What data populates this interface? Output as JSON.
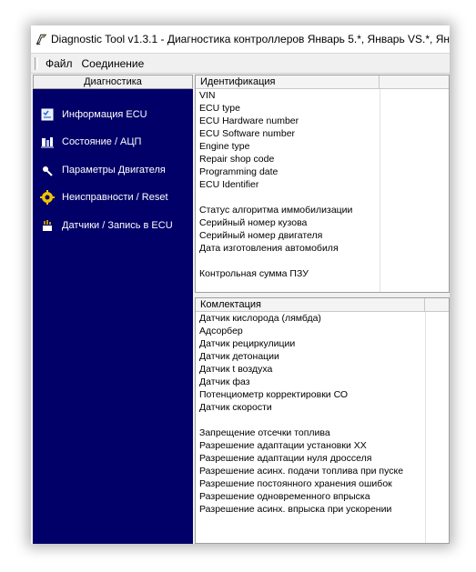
{
  "window": {
    "title": "Diagnostic Tool v1.3.1 - Диагностика контроллеров Январь 5.*, Январь VS.*, Ян"
  },
  "menu": [
    {
      "label": "Файл"
    },
    {
      "label": "Соединение"
    }
  ],
  "sidebar": {
    "header": "Диагностика",
    "items": [
      {
        "label": "Информация ECU",
        "icon": "info-checklist-icon"
      },
      {
        "label": "Состояние / АЦП",
        "icon": "gauge-icon"
      },
      {
        "label": "Параметры Двигателя",
        "icon": "engine-spark-icon"
      },
      {
        "label": "Неисправности / Reset",
        "icon": "warning-gear-icon"
      },
      {
        "label": "Датчики / Запись в ECU",
        "icon": "sensor-write-icon"
      }
    ]
  },
  "identification": {
    "header": "Идентификация",
    "rows": [
      "VIN",
      "ECU type",
      "ECU Hardware number",
      "ECU Software number",
      "Engine type",
      "Repair shop code",
      "Programming date",
      "ECU Identifier",
      "",
      "Статус алгоритма иммобилизации",
      "Серийный номер кузова",
      "Серийный номер двигателя",
      "Дата изготовления автомобиля",
      "",
      "Контрольная сумма ПЗУ"
    ]
  },
  "equipment": {
    "header": "Комлектация",
    "rows": [
      "Датчик кислорода (лямбда)",
      "Адсорбер",
      "Датчик рециркулиции",
      "Датчик детонации",
      "Датчик t воздуха",
      "Датчик фаз",
      "Потенциометр корректировки СО",
      "Датчик скорости",
      "",
      "Запрещение отсечки топлива",
      "Разрешение адаптации установки ХХ",
      "Разрешение адаптации нуля дросселя",
      "Разрешение асинх. подачи топлива при пуске",
      "Разрешение постоянного хранения ошибок",
      "Разрешение одновременного впрыска",
      "Разрешение асинх. впрыска при ускорении"
    ]
  }
}
